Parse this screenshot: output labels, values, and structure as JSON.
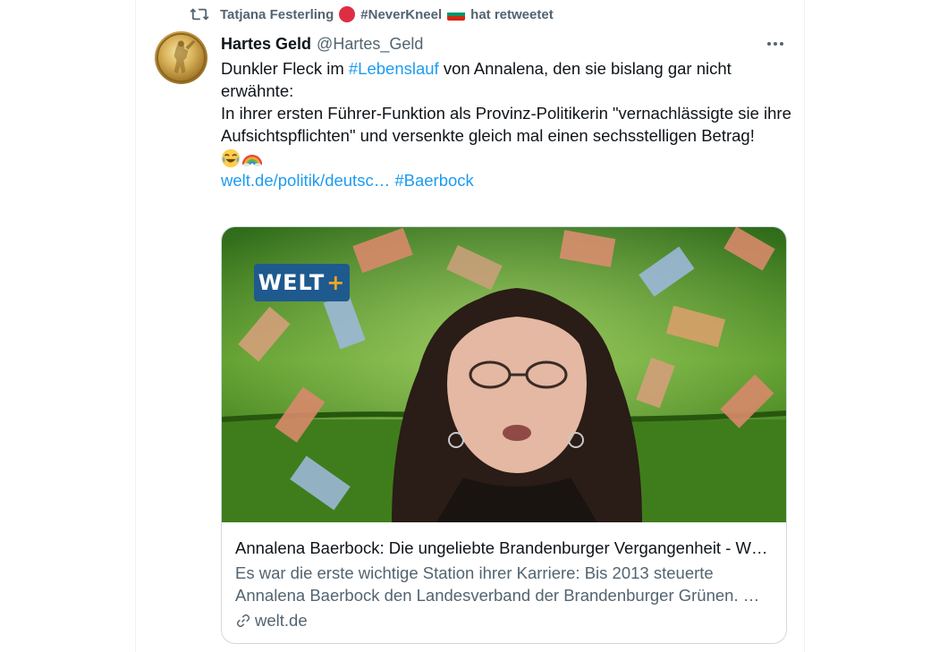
{
  "retweet": {
    "retweeter_name": "Tatjana Festerling",
    "hashtag": "#NeverKneel",
    "action": "hat retweetet"
  },
  "tweet": {
    "display_name": "Hartes Geld",
    "handle": "@Hartes_Geld",
    "text_part1": "Dunkler Fleck im ",
    "hashtag_lebenslauf": "#Lebenslauf",
    "text_part2": " von Annalena, den sie bislang gar nicht erwähnte:",
    "text_line2": "In ihrer ersten Führer-Funktion als Provinz-Politikerin \"vernachlässigte sie ihre Aufsichtspflichten\" und versenkte gleich mal einen sechsstelligen Betrag!",
    "url_text": "welt.de/politik/deutsc…",
    "hashtag_baerbock": "#Baerbock"
  },
  "card": {
    "badge_text": "WELT",
    "badge_plus": "+",
    "title": "Annalena Baerbock: Die ungeliebte Brandenburger Vergangenheit - W…",
    "description": "Es war die erste wichtige Station ihrer Karriere: Bis 2013 steuerte Annalena Baerbock den Landesverband der Brandenburger Grünen. …",
    "domain": "welt.de"
  },
  "icons": [
    "retweet-icon",
    "red-circle-icon",
    "bulgaria-flag-icon",
    "more-icon",
    "laughing-emoji-icon",
    "rainbow-emoji-icon",
    "link-icon"
  ],
  "colors": {
    "link": "#1d9bf0",
    "secondary": "#536471",
    "border": "#cfd9de",
    "welt_blue": "#1e5a8e"
  }
}
